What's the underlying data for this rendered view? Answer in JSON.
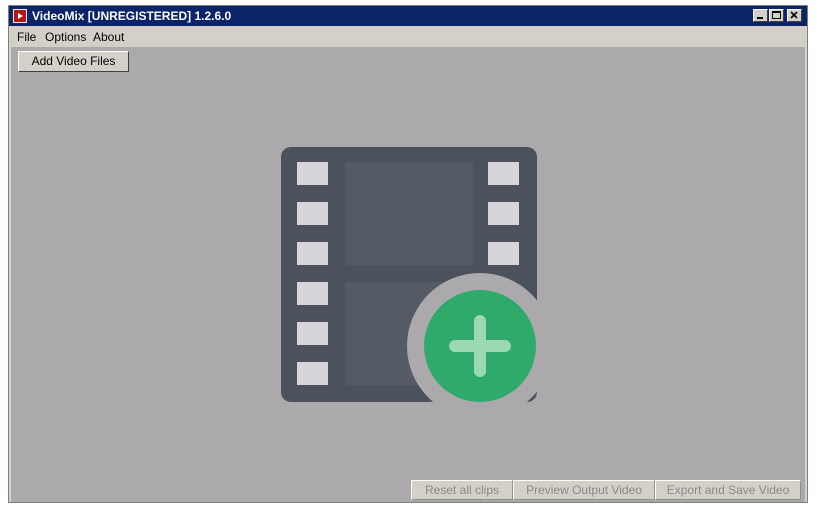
{
  "window": {
    "title": "VideoMix [UNREGISTERED] 1.2.6.0",
    "icons": {
      "app": "videomix-app-icon",
      "minimize": "minimize-icon",
      "maximize": "maximize-icon",
      "close": "close-icon"
    }
  },
  "menu": {
    "items": [
      "File",
      "Options",
      "About"
    ]
  },
  "toolbar": {
    "add_label": "Add Video Files"
  },
  "drop_zone": {
    "icon": "film-strip-add-icon",
    "colors": {
      "film": "#4c525c",
      "frame": "#555b64",
      "plus_circle": "#2faa6a"
    }
  },
  "footer": {
    "reset_label": "Reset all clips",
    "preview_label": "Preview Output Video",
    "export_label": "Export and Save Video"
  }
}
